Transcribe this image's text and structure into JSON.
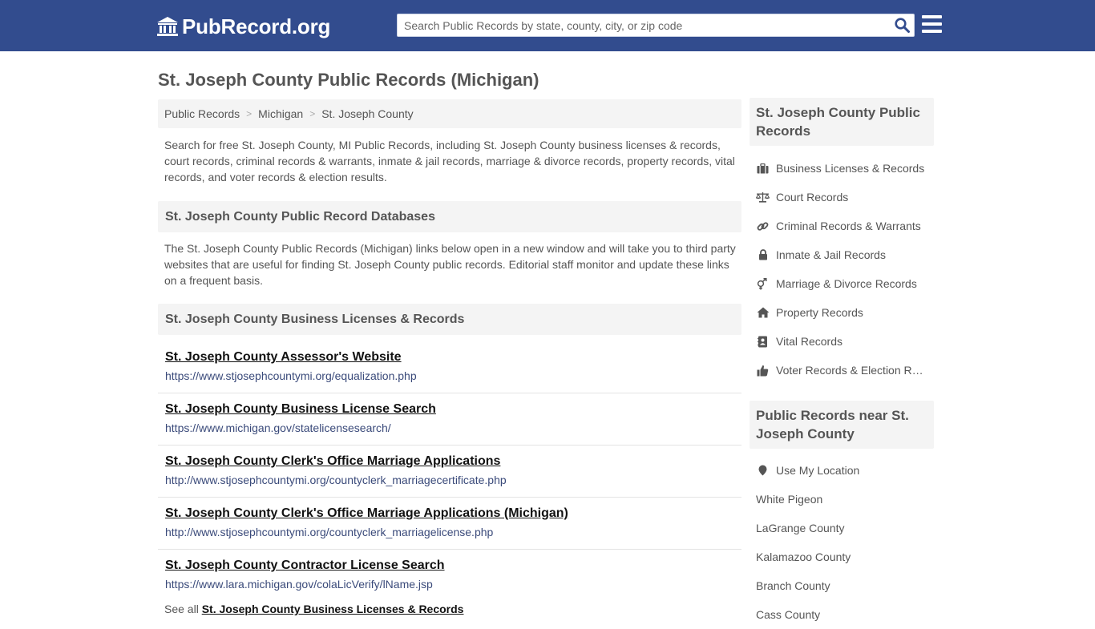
{
  "header": {
    "logo_text": "PubRecord.org",
    "search_placeholder": "Search Public Records by state, county, city, or zip code",
    "brand_color": "#324c8e"
  },
  "page": {
    "title": "St. Joseph County Public Records (Michigan)"
  },
  "breadcrumb": {
    "items": [
      "Public Records",
      "Michigan",
      "St. Joseph County"
    ],
    "separator": ">"
  },
  "intro": "Search for free St. Joseph County, MI Public Records, including St. Joseph County business licenses & records, court records, criminal records & warrants, inmate & jail records, marriage & divorce records, property records, vital records, and voter records & election results.",
  "databases": {
    "heading": "St. Joseph County Public Record Databases",
    "description": "The St. Joseph County Public Records (Michigan) links below open in a new window and will take you to third party websites that are useful for finding St. Joseph County public records. Editorial staff monitor and update these links on a frequent basis."
  },
  "business": {
    "heading": "St. Joseph County Business Licenses & Records",
    "records": [
      {
        "title": "St. Joseph County Assessor's Website",
        "url": "https://www.stjosephcountymi.org/equalization.php"
      },
      {
        "title": "St. Joseph County Business License Search",
        "url": "https://www.michigan.gov/statelicensesearch/"
      },
      {
        "title": "St. Joseph County Clerk's Office Marriage Applications",
        "url": "http://www.stjosephcountymi.org/countyclerk_marriagecertificate.php"
      },
      {
        "title": "St. Joseph County Clerk's Office Marriage Applications (Michigan)",
        "url": "http://www.stjosephcountymi.org/countyclerk_marriagelicense.php"
      },
      {
        "title": "St. Joseph County Contractor License Search",
        "url": "https://www.lara.michigan.gov/colaLicVerify/lName.jsp"
      }
    ],
    "see_all_prefix": "See all",
    "see_all_link": "St. Joseph County Business Licenses & Records"
  },
  "sidebar": {
    "records_heading": "St. Joseph County Public Records",
    "categories": [
      {
        "label": "Business Licenses & Records",
        "icon": "briefcase-icon"
      },
      {
        "label": "Court Records",
        "icon": "scale-icon"
      },
      {
        "label": "Criminal Records & Warrants",
        "icon": "link-icon"
      },
      {
        "label": "Inmate & Jail Records",
        "icon": "lock-icon"
      },
      {
        "label": "Marriage & Divorce Records",
        "icon": "gender-icon"
      },
      {
        "label": "Property Records",
        "icon": "home-icon"
      },
      {
        "label": "Vital Records",
        "icon": "contact-book-icon"
      },
      {
        "label": "Voter Records & Election Results",
        "icon": "thumbs-up-icon"
      }
    ],
    "near_heading": "Public Records near St. Joseph County",
    "use_location": "Use My Location",
    "nearby": [
      "White Pigeon",
      "LaGrange County",
      "Kalamazoo County",
      "Branch County",
      "Cass County"
    ]
  }
}
